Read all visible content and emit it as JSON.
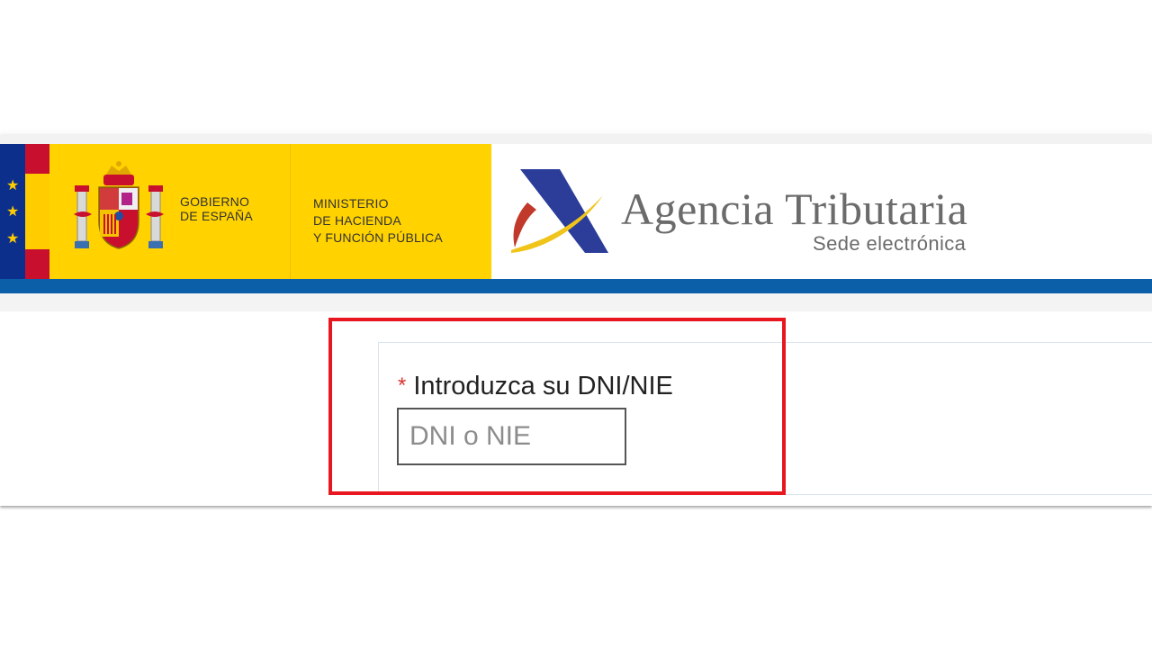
{
  "header": {
    "gov_lines": [
      "GOBIERNO",
      "DE ESPAÑA"
    ],
    "ministry_lines": [
      "MINISTERIO",
      "DE HACIENDA",
      "Y FUNCIÓN PÚBLICA"
    ],
    "agency_title": "Agencia Tributaria",
    "agency_subtitle": "Sede electrónica",
    "coat_of_arms_icon": "spain-coat-of-arms-icon",
    "agency_logo_icon": "aeat-logo-icon",
    "eu_stars_icon": "eu-stars-icon"
  },
  "form": {
    "required_mark": "*",
    "field_label": "Introduzca su DNI/NIE",
    "input_placeholder": "DNI o NIE",
    "input_value": ""
  },
  "colors": {
    "brand_yellow": "#ffd200",
    "brand_blue_bar": "#0b5ea8",
    "highlight_red": "#e8161e",
    "required_red": "#d9322c",
    "agency_text_grey": "#6b6b6b"
  }
}
